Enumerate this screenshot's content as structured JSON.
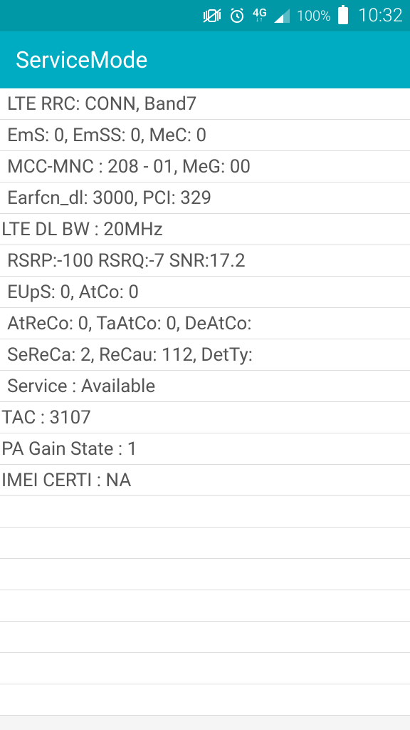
{
  "status": {
    "network_label": "4G",
    "network_arrows": "↓↑",
    "battery_pct": "100%",
    "time": "10:32"
  },
  "app": {
    "title": "ServiceMode"
  },
  "rows": [
    "LTE RRC: CONN, Band7",
    "EmS: 0, EmSS: 0, MeC: 0",
    "MCC-MNC : 208 - 01, MeG: 00",
    "Earfcn_dl: 3000, PCI: 329",
    "LTE DL BW : 20MHz",
    "RSRP:-100 RSRQ:-7 SNR:17.2",
    "EUpS: 0, AtCo: 0",
    "AtReCo: 0, TaAtCo: 0, DeAtCo:",
    "SeReCa: 2, ReCau: 112, DetTy:",
    "Service : Available",
    "TAC : 3107",
    "PA Gain State : 1",
    "IMEI CERTI : NA",
    "",
    "",
    "",
    "",
    "",
    "",
    ""
  ],
  "noindent_rows": [
    4,
    10,
    11,
    12
  ]
}
